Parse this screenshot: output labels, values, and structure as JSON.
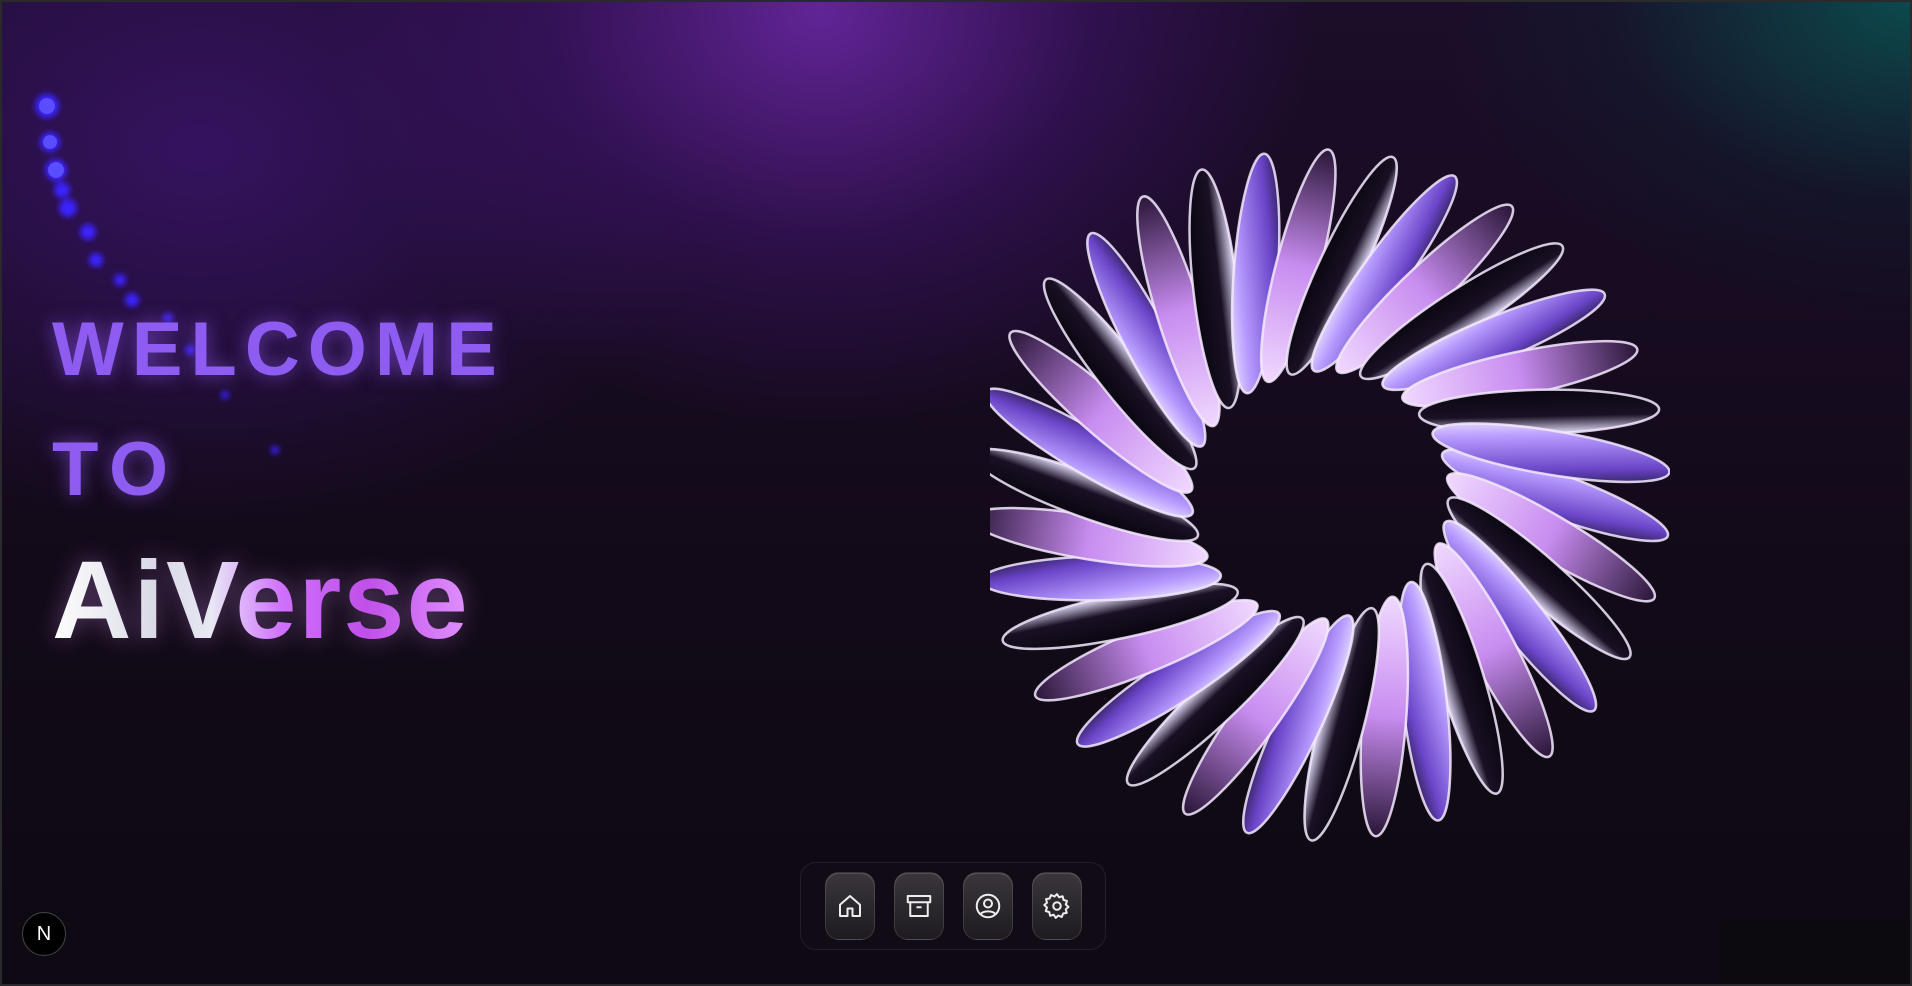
{
  "hero": {
    "line1": "WELCOME",
    "line2": "TO",
    "brand": "AiVerse"
  },
  "dock": {
    "items": [
      {
        "icon": "home-icon"
      },
      {
        "icon": "archive-icon"
      },
      {
        "icon": "user-icon"
      },
      {
        "icon": "gear-icon"
      }
    ]
  },
  "badge": {
    "label": "N"
  },
  "colors": {
    "accent": "#8f5cf2",
    "glow": "#d070ff",
    "background": "#0e0912"
  }
}
